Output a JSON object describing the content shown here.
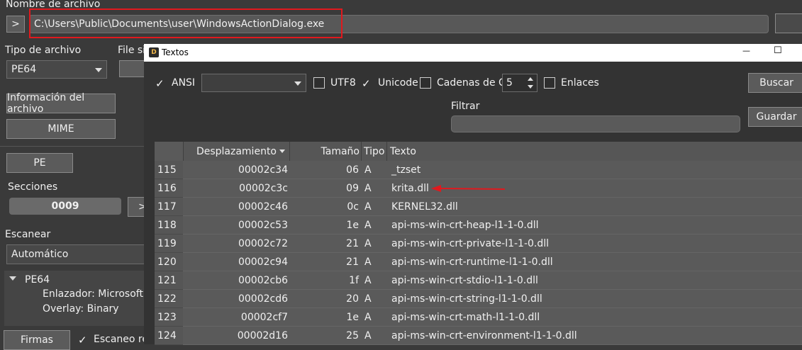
{
  "main": {
    "filename_label": "Nombre de archivo",
    "browse_button": ">",
    "filename_value": "C:\\Users\\Public\\Documents\\user\\WindowsActionDialog.exe",
    "file_type_label": "Tipo de archivo",
    "file_size_label": "File siz",
    "file_type_value": "PE64",
    "file_info_button": "Información del archivo",
    "mime_button": "MIME",
    "pe_button": "PE",
    "sections_label": "Secciones",
    "sections_value": "0009",
    "sections_button": ">",
    "scan_label": "Escanear",
    "scan_value": "Automático",
    "tree": {
      "root": "PE64",
      "linker": "Enlazador: Microsoft l",
      "overlay": "Overlay: Binary"
    },
    "signatures_button": "Firmas",
    "recursive_scan_label": "Escaneo rec"
  },
  "dialog": {
    "title": "Textos",
    "minimize": "—",
    "maximize": "☐",
    "options": {
      "ansi": "ANSI",
      "ansi_checked": true,
      "utf8": "UTF8",
      "utf8_checked": false,
      "unicode": "Unicode",
      "unicode_checked": true,
      "c_strings": "Cadenas de C",
      "c_strings_checked": false,
      "min_length": "5",
      "links": "Enlaces",
      "links_checked": false
    },
    "search_button": "Buscar",
    "save_button": "Guardar",
    "filter_label": "Filtrar",
    "filter_value": "",
    "columns": [
      "Desplazamiento",
      "Tamaño",
      "Tipo",
      "Texto"
    ],
    "rows": [
      {
        "n": "115",
        "offset": "00002c34",
        "size": "06",
        "type": "A",
        "text": "_tzset"
      },
      {
        "n": "116",
        "offset": "00002c3c",
        "size": "09",
        "type": "A",
        "text": "krita.dll"
      },
      {
        "n": "117",
        "offset": "00002c46",
        "size": "0c",
        "type": "A",
        "text": "KERNEL32.dll"
      },
      {
        "n": "118",
        "offset": "00002c53",
        "size": "1e",
        "type": "A",
        "text": "api-ms-win-crt-heap-l1-1-0.dll"
      },
      {
        "n": "119",
        "offset": "00002c72",
        "size": "21",
        "type": "A",
        "text": "api-ms-win-crt-private-l1-1-0.dll"
      },
      {
        "n": "120",
        "offset": "00002c94",
        "size": "21",
        "type": "A",
        "text": "api-ms-win-crt-runtime-l1-1-0.dll"
      },
      {
        "n": "121",
        "offset": "00002cb6",
        "size": "1f",
        "type": "A",
        "text": "api-ms-win-crt-stdio-l1-1-0.dll"
      },
      {
        "n": "122",
        "offset": "00002cd6",
        "size": "20",
        "type": "A",
        "text": "api-ms-win-crt-string-l1-1-0.dll"
      },
      {
        "n": "123",
        "offset": "00002cf7",
        "size": "1e",
        "type": "A",
        "text": "api-ms-win-crt-math-l1-1-0.dll"
      },
      {
        "n": "124",
        "offset": "00002d16",
        "size": "25",
        "type": "A",
        "text": "api-ms-win-crt-environment-l1-1-0.dll"
      }
    ]
  },
  "colors": {
    "annotation": "#e0191e",
    "window_bg": "#3a3a3a",
    "dialog_bg": "#333333",
    "row_bg": "#5a5a5a"
  }
}
